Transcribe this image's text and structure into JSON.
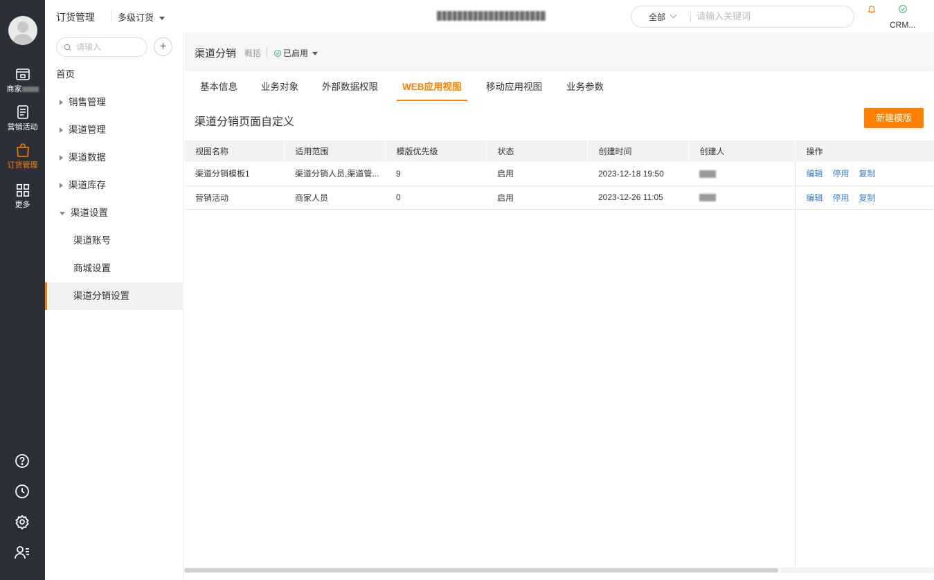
{
  "rail": {
    "items": [
      {
        "label": "商家",
        "icon": "store-icon"
      },
      {
        "label": "营销活动",
        "icon": "campaign-icon"
      },
      {
        "label": "订货管理",
        "icon": "bag-icon",
        "active": true
      },
      {
        "label": "更多",
        "icon": "grid-icon"
      }
    ],
    "bottom_icons": [
      "help-icon",
      "history-icon",
      "settings-icon",
      "user-list-icon"
    ]
  },
  "header": {
    "app_title": "订货管理",
    "module_selector": "多级订货",
    "search_scope": "全部",
    "search_placeholder": "请输入关键词",
    "crm_label": "CRM..."
  },
  "sidebar": {
    "search_placeholder": "请输入",
    "items": [
      {
        "label": "首页"
      },
      {
        "label": "销售管理"
      },
      {
        "label": "渠道管理"
      },
      {
        "label": "渠道数据"
      },
      {
        "label": "渠道库存"
      },
      {
        "label": "渠道设置"
      },
      {
        "label": "渠道账号"
      },
      {
        "label": "商城设置"
      },
      {
        "label": "渠道分销设置"
      }
    ]
  },
  "object": {
    "title": "渠道分销",
    "subtitle": "概括",
    "status": "已启用"
  },
  "tabs": [
    {
      "label": "基本信息"
    },
    {
      "label": "业务对象"
    },
    {
      "label": "外部数据权限"
    },
    {
      "label": "WEB应用视图",
      "active": true
    },
    {
      "label": "移动应用视图"
    },
    {
      "label": "业务参数"
    }
  ],
  "section": {
    "title": "渠道分销页面自定义",
    "new_button": "新建模版"
  },
  "table": {
    "headers": [
      "视图名称",
      "适用范围",
      "模版优先级",
      "状态",
      "创建时间",
      "创建人",
      "操作"
    ],
    "rows": [
      {
        "name": "渠道分销模板1",
        "scope": "渠道分销人员,渠道管...",
        "priority": "9",
        "status": "启用",
        "created": "2023-12-18 19:50",
        "actions": [
          "编辑",
          "停用",
          "复制"
        ]
      },
      {
        "name": "营销活动",
        "scope": "商家人员",
        "priority": "0",
        "status": "启用",
        "created": "2023-12-26 11:05",
        "actions": [
          "编辑",
          "停用",
          "复制"
        ]
      }
    ]
  },
  "colors": {
    "accent": "#ff8000",
    "rail_bg": "#2b2f38",
    "link": "#3880d4"
  }
}
